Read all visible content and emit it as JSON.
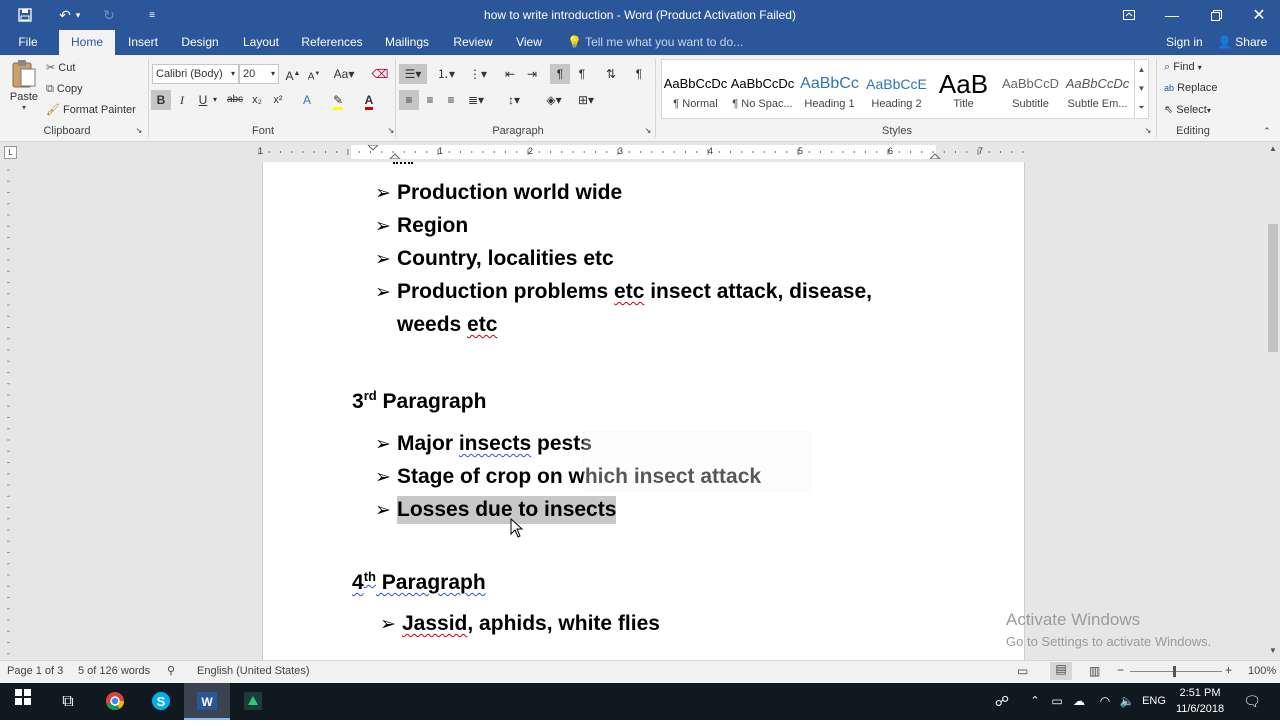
{
  "titlebar": {
    "title": "how to write introduction - Word (Product Activation Failed)",
    "save_icon": "save-icon",
    "undo_icon": "undo-icon",
    "redo_icon": "redo-icon",
    "customize_icon": "customize-icon"
  },
  "tabs": [
    "File",
    "Home",
    "Insert",
    "Design",
    "Layout",
    "References",
    "Mailings",
    "Review",
    "View"
  ],
  "tell_me": "Tell me what you want to do...",
  "sign_in": "Sign in",
  "share": "Share",
  "clipboard": {
    "paste": "Paste",
    "cut": "Cut",
    "copy": "Copy",
    "format_painter": "Format Painter",
    "label": "Clipboard"
  },
  "font": {
    "family": "Calibri (Body)",
    "size": "20",
    "label": "Font"
  },
  "paragraph": {
    "label": "Paragraph"
  },
  "styles": {
    "label": "Styles",
    "items": [
      {
        "sample": "AaBbCcDc",
        "name": "¶ Normal"
      },
      {
        "sample": "AaBbCcDc",
        "name": "¶ No Spac..."
      },
      {
        "sample": "AaBbCc",
        "name": "Heading 1"
      },
      {
        "sample": "AaBbCcE",
        "name": "Heading 2"
      },
      {
        "sample": "AaB",
        "name": "Title"
      },
      {
        "sample": "AaBbCcD",
        "name": "Subtitle"
      },
      {
        "sample": "AaBbCcDc",
        "name": "Subtle Em..."
      }
    ]
  },
  "editing": {
    "find": "Find",
    "replace": "Replace",
    "select": "Select",
    "label": "Editing"
  },
  "ruler": {
    "numbers": [
      "1",
      "1",
      "2",
      "3",
      "4",
      "5",
      "6",
      "7"
    ]
  },
  "document": {
    "list1": [
      "Production world wide",
      "Region",
      "Country, localities etc"
    ],
    "list1_last_a": "Production problems ",
    "list1_last_b": "etc",
    "list1_last_c": " insect attack, disease,",
    "list1_wrap_a": "weeds ",
    "list1_wrap_b": "etc",
    "heading3_num": "3",
    "heading3_sup": "rd",
    "heading3_text": " Paragraph",
    "list2_a1": "Major ",
    "list2_a2": "insects",
    "list2_a3": " pests",
    "list2_b": "Stage of crop on which insect attack",
    "list2_c": "Losses due to insects",
    "heading4_num": "4",
    "heading4_sup": "th",
    "heading4_text": "  Paragraph",
    "list3_a": "Jassid",
    "list3_b": ", aphids, white flies"
  },
  "watermark": {
    "line1": "Activate Windows",
    "line2": "Go to Settings to activate Windows."
  },
  "status": {
    "page": "Page 1 of 3",
    "words": "5 of 126 words",
    "language": "English (United States)",
    "zoom": "100%"
  },
  "taskbar": {
    "lang": "ENG",
    "time": "2:51 PM",
    "date": "11/6/2018"
  }
}
